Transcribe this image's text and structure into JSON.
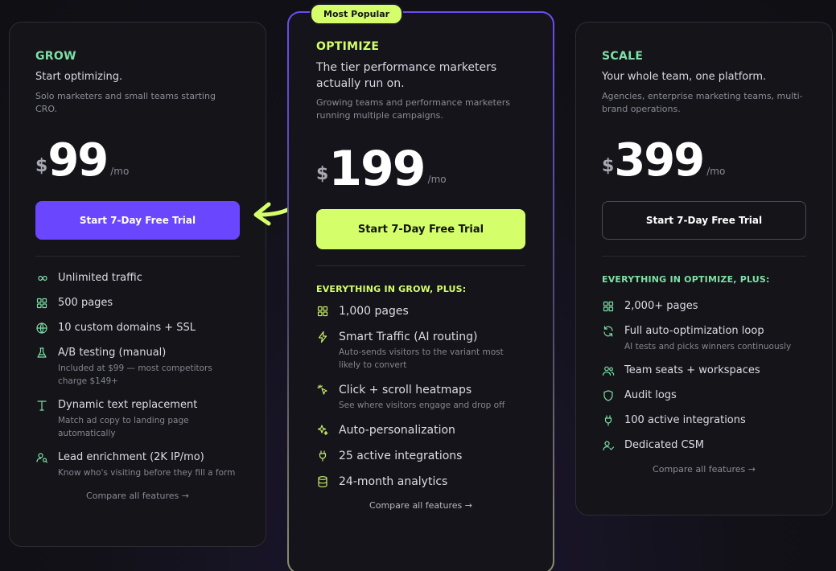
{
  "badge": "Most Popular",
  "plans": {
    "grow": {
      "name": "GROW",
      "tagline": "Start optimizing.",
      "audience": "Solo marketers and small teams starting CRO.",
      "currency": "$",
      "price": "99",
      "period": "/mo",
      "cta": "Start 7-Day Free Trial",
      "features": [
        {
          "icon": "infinity-icon",
          "label": "Unlimited traffic"
        },
        {
          "icon": "grid-icon",
          "label": "500 pages"
        },
        {
          "icon": "globe-icon",
          "label": "10 custom domains + SSL"
        },
        {
          "icon": "flask-icon",
          "label": "A/B testing (manual)",
          "sub": "Included at $99 — most competitors charge $149+"
        },
        {
          "icon": "text-icon",
          "label": "Dynamic text replacement",
          "sub": "Match ad copy to landing page automatically"
        },
        {
          "icon": "user-search-icon",
          "label": "Lead enrichment (2K IP/mo)",
          "sub": "Know who's visiting before they fill a form"
        }
      ],
      "compare": "Compare all features →"
    },
    "optimize": {
      "name": "OPTIMIZE",
      "tagline": "The tier performance marketers actually run on.",
      "audience": "Growing teams and performance marketers running multiple campaigns.",
      "currency": "$",
      "price": "199",
      "period": "/mo",
      "cta": "Start 7-Day Free Trial",
      "section_head": "EVERYTHING IN GROW, PLUS:",
      "features": [
        {
          "icon": "grid-icon",
          "label": "1,000 pages"
        },
        {
          "icon": "lightning-icon",
          "label": "Smart Traffic (AI routing)",
          "sub": "Auto-sends visitors to the variant most likely to convert"
        },
        {
          "icon": "cursor-click-icon",
          "label": "Click + scroll heatmaps",
          "sub": "See where visitors engage and drop off"
        },
        {
          "icon": "sparkles-icon",
          "label": "Auto-personalization"
        },
        {
          "icon": "plug-icon",
          "label": "25 active integrations"
        },
        {
          "icon": "database-icon",
          "label": "24-month analytics"
        }
      ],
      "compare": "Compare all features →"
    },
    "scale": {
      "name": "SCALE",
      "tagline": "Your whole team, one platform.",
      "audience": "Agencies, enterprise marketing teams, multi-brand operations.",
      "currency": "$",
      "price": "399",
      "period": "/mo",
      "cta": "Start 7-Day Free Trial",
      "section_head": "EVERYTHING IN OPTIMIZE, PLUS:",
      "features": [
        {
          "icon": "grid-icon",
          "label": "2,000+ pages"
        },
        {
          "icon": "refresh-icon",
          "label": "Full auto-optimization loop",
          "sub": "AI tests and picks winners continuously"
        },
        {
          "icon": "users-icon",
          "label": "Team seats + workspaces"
        },
        {
          "icon": "shield-icon",
          "label": "Audit logs"
        },
        {
          "icon": "plug-icon",
          "label": "100 active integrations"
        },
        {
          "icon": "user-check-icon",
          "label": "Dedicated CSM"
        }
      ],
      "compare": "Compare all features →"
    }
  },
  "colors": {
    "grow_accent": "#7ee0a6",
    "optimize_accent": "#d4ff6a",
    "grow_button": "#6a46ff",
    "optimize_button": "#d4ff6a"
  }
}
